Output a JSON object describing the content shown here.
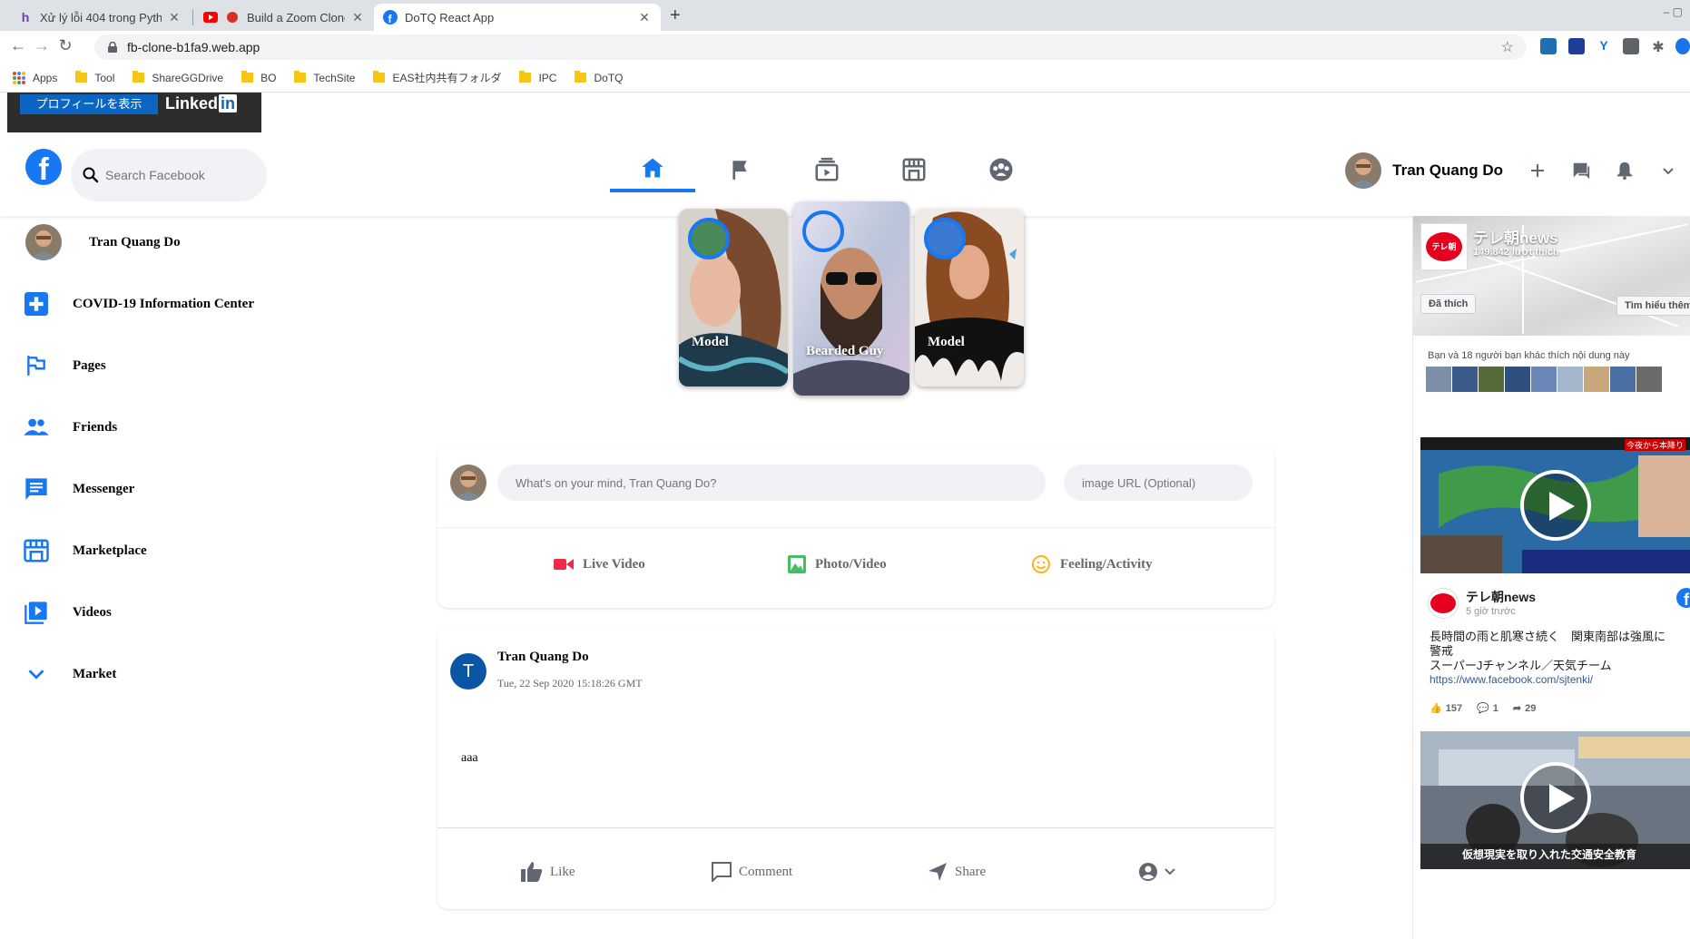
{
  "browser": {
    "tabs": [
      {
        "title": "Xử lý lỗi 404 trong Python Djang",
        "close": "✕"
      },
      {
        "title": "Build a Zoom Clone with Node",
        "close": "✕"
      },
      {
        "title": "DoTQ React App",
        "close": "✕"
      }
    ],
    "new_tab": "+",
    "window_controls": "–  ▢",
    "url": "fb-clone-b1fa9.web.app",
    "bookmarks": [
      "Apps",
      "Tool",
      "ShareGGDrive",
      "BO",
      "TechSite",
      "EAS社内共有フォルダ",
      "IPC",
      "DoTQ"
    ]
  },
  "linkedin": {
    "profile_button": "プロフィールを表示",
    "brand": "Linked",
    "brand_in": "in"
  },
  "header": {
    "logo": "f",
    "search_placeholder": "Search Facebook",
    "user_name": "Tran Quang Do",
    "nav_icons": [
      "home-icon",
      "flag-icon",
      "watch-icon",
      "marketplace-icon",
      "groups-icon"
    ],
    "actions": [
      "plus-icon",
      "messenger-icon",
      "bell-icon",
      "chevron-down-icon"
    ]
  },
  "sidebar": {
    "items": [
      {
        "label": "Tran Quang Do",
        "icon": "avatar"
      },
      {
        "label": "COVID-19 Information Center",
        "icon": "medical-cross-icon"
      },
      {
        "label": "Pages",
        "icon": "flag-icon"
      },
      {
        "label": "Friends",
        "icon": "people-icon"
      },
      {
        "label": "Messenger",
        "icon": "chat-icon"
      },
      {
        "label": "Marketplace",
        "icon": "store-icon"
      },
      {
        "label": "Videos",
        "icon": "video-library-icon"
      },
      {
        "label": "Market",
        "icon": "chevron-down-icon"
      }
    ]
  },
  "stories": [
    {
      "name": "Model"
    },
    {
      "name": "Bearded Guy"
    },
    {
      "name": "Model"
    }
  ],
  "composer": {
    "placeholder": "What's on your mind, Tran Quang Do?",
    "url_placeholder": "image URL (Optional)",
    "options": [
      {
        "label": "Live Video",
        "color": "#f02849"
      },
      {
        "label": "Photo/Video",
        "color": "#45bd62"
      },
      {
        "label": "Feeling/Activity",
        "color": "#f7b928"
      }
    ]
  },
  "post": {
    "avatar_letter": "T",
    "author": "Tran Quang Do",
    "timestamp": "Tue, 22 Sep 2020 15:18:26 GMT",
    "body": "aaa",
    "actions": [
      "Like",
      "Comment",
      "Share"
    ]
  },
  "widget": {
    "page_name": "テレ朝news",
    "likes": "149.842 lượt thích",
    "logo_text": "テレ朝",
    "liked_button": "Đã thích",
    "learn_more": "Tìm hiểu thêm",
    "friends_text": "Bạn và 18 người bạn khác thích nội dung này",
    "post_time": "5 giờ trước",
    "post_line1": "長時間の雨と肌寒さ続く　関東南部は強風に",
    "post_line2": "警戒",
    "post_line3": "スーパーJチャンネル／天気チーム",
    "post_link": "https://www.facebook.com/sjtenki/",
    "stats": {
      "likes": "157",
      "comments": "1",
      "shares": "29"
    },
    "video1_caption_top": "今夜から本降り",
    "video2_caption": "仮想現実を取り入れた交通安全教育"
  },
  "colors": {
    "fb_blue": "#1877f2",
    "text_primary": "#050505",
    "text_secondary": "#65676b",
    "bg_input": "#f0f2f5"
  }
}
